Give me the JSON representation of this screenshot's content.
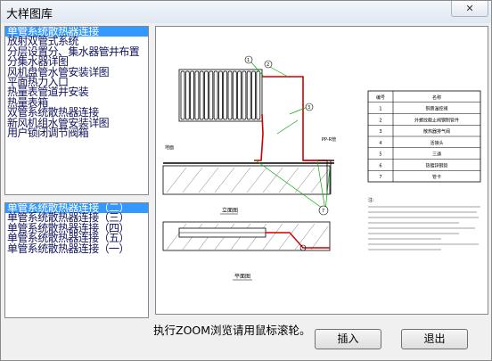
{
  "window": {
    "title": "大样图库",
    "close_glyph": "✕"
  },
  "category_list": {
    "items": [
      {
        "label": "单管系统散热器连接",
        "selected": true
      },
      {
        "label": "放射双管式系统",
        "selected": false
      },
      {
        "label": "分层设置分、集水器管井布置",
        "selected": false
      },
      {
        "label": "分集水器详图",
        "selected": false
      },
      {
        "label": "风机盘管水管安装详图",
        "selected": false
      },
      {
        "label": "平面热力入口",
        "selected": false
      },
      {
        "label": "热量表管道井安装",
        "selected": false
      },
      {
        "label": "热量表箱",
        "selected": false
      },
      {
        "label": "双管系统散热器连接",
        "selected": false
      },
      {
        "label": "新风机组水管安装详图",
        "selected": false
      },
      {
        "label": "用户锁闭调节阀箱",
        "selected": false
      }
    ]
  },
  "detail_list": {
    "items": [
      {
        "label": "单管系统散热器连接（二）",
        "selected": true
      },
      {
        "label": "单管系统散热器连接（三）",
        "selected": false
      },
      {
        "label": "单管系统散热器连接（四）",
        "selected": false
      },
      {
        "label": "单管系统散热器连接（五）",
        "selected": false
      },
      {
        "label": "单管系统散热器连接（一）",
        "selected": false
      }
    ]
  },
  "preview": {
    "elevation_label": "立面图",
    "plan_label": "平面图",
    "legend_header": [
      "编号",
      "名称"
    ],
    "legend_rows": [
      {
        "no": "1",
        "name": "铜质温控阀"
      },
      {
        "no": "2",
        "name": "外螺纹截止阀钢制管件"
      },
      {
        "no": "3",
        "name": "散热器排气阀"
      },
      {
        "no": "4",
        "name": "活接头"
      },
      {
        "no": "5",
        "name": "三通"
      },
      {
        "no": "6",
        "name": "热镀锌钢管"
      },
      {
        "no": "7",
        "name": "管卡"
      }
    ],
    "notes_title": "注:",
    "callouts": [
      "1",
      "2",
      "3",
      "4",
      "5",
      "6",
      "7"
    ],
    "tag_floor": "地面",
    "tag_pipe": "PP-R管"
  },
  "hint": "执行ZOOM浏览请用鼠标滚轮。",
  "buttons": {
    "insert": "插入",
    "exit": "退出"
  },
  "colors": {
    "selection": "#3399ff",
    "list_text": "#12145c",
    "pipe_red": "#cc0000",
    "leader_green": "#00aa00"
  }
}
